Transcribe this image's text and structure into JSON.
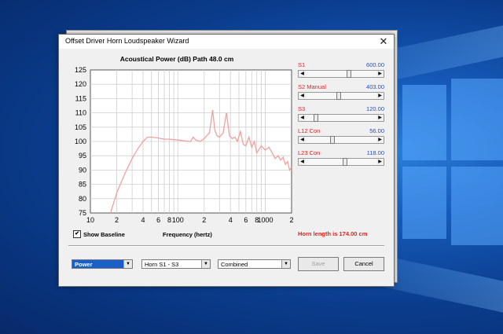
{
  "window": {
    "title": "Offset Driver Horn Loudspeaker Wizard"
  },
  "chart_data": {
    "type": "line",
    "title": "Acoustical Power (dB)   Path 48.0 cm",
    "xlabel": "Frequency (hertz)",
    "ylabel": "",
    "xscale": "log",
    "xlim": [
      10,
      2000
    ],
    "ylim": [
      75,
      125
    ],
    "yticks": [
      75,
      80,
      85,
      90,
      95,
      100,
      105,
      110,
      115,
      120,
      125
    ],
    "xtick_labels": [
      "10",
      "2",
      "4",
      "6",
      "8",
      "100",
      "2",
      "4",
      "6",
      "8",
      "1000",
      "2"
    ],
    "xtick_values": [
      10,
      20,
      40,
      60,
      80,
      100,
      200,
      400,
      600,
      800,
      1000,
      2000
    ],
    "grid": true,
    "series": [
      {
        "color": "#f0a0a0",
        "x": [
          17,
          20,
          25,
          30,
          35,
          40,
          45,
          50,
          60,
          70,
          80,
          100,
          120,
          140,
          150,
          160,
          180,
          200,
          230,
          250,
          265,
          280,
          300,
          330,
          360,
          390,
          420,
          450,
          480,
          520,
          560,
          600,
          650,
          700,
          750,
          800,
          900,
          1000,
          1100,
          1200,
          1300,
          1400,
          1500,
          1600,
          1700,
          1800,
          1900,
          2000
        ],
        "y": [
          75,
          82,
          89,
          94,
          97.5,
          100,
          101.5,
          101.5,
          101.2,
          100.8,
          100.8,
          100.5,
          100.2,
          100,
          101.5,
          100.5,
          100,
          101,
          103,
          111,
          104,
          102,
          101.5,
          103,
          110,
          102,
          101,
          101.5,
          100,
          103.5,
          99,
          98.5,
          101.5,
          98,
          100,
          96,
          98.5,
          97,
          98,
          96,
          94,
          95,
          93.5,
          94.5,
          92,
          93,
          90,
          91
        ]
      }
    ]
  },
  "params": [
    {
      "label": "S1",
      "value": "600.00",
      "thumb": 0.6
    },
    {
      "label": "S2  Manual",
      "value": "403.00",
      "thumb": 0.45
    },
    {
      "label": "S3",
      "value": "120.00",
      "thumb": 0.12
    },
    {
      "label": "L12  Con",
      "value": "56.00",
      "thumb": 0.36
    },
    {
      "label": "L23  Con",
      "value": "118.00",
      "thumb": 0.55
    }
  ],
  "show_baseline": {
    "label": "Show Baseline",
    "checked": "✔"
  },
  "horn_length_text": "Horn length is 174.00 cm",
  "controls": {
    "mode": "Power",
    "section": "Horn S1 - S3",
    "view": "Combined",
    "save": "Save",
    "cancel": "Cancel"
  }
}
